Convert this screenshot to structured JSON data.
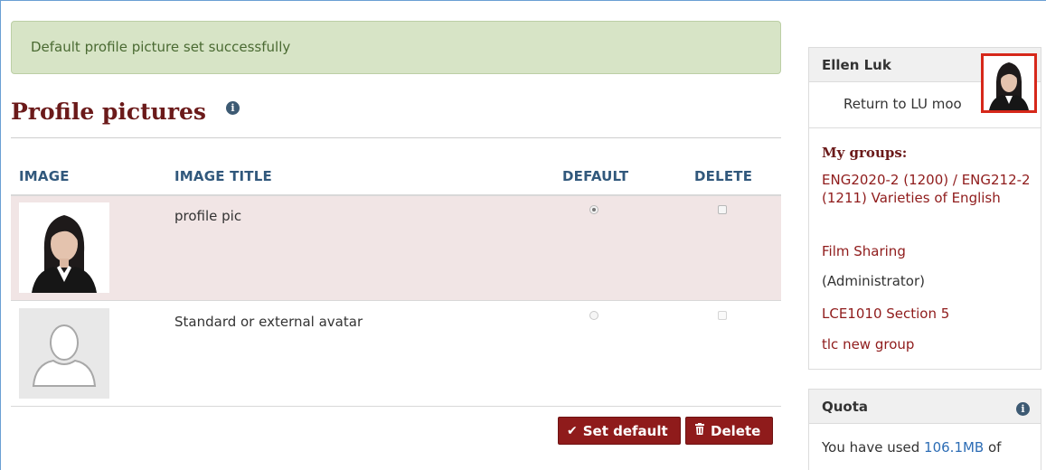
{
  "alert": {
    "message": "Default profile picture set successfully"
  },
  "page": {
    "title": "Profile pictures",
    "info_icon": "info-circle-icon"
  },
  "table": {
    "headers": {
      "image": "IMAGE",
      "title": "IMAGE TITLE",
      "default": "DEFAULT",
      "delete": "DELETE"
    },
    "rows": [
      {
        "title": "profile pic",
        "default_selected": true,
        "delete_enabled": true
      },
      {
        "title": "Standard or external avatar",
        "default_selected": false,
        "delete_enabled": false
      }
    ]
  },
  "actions": {
    "set_default_label": "Set default",
    "set_default_icon": "check-icon",
    "delete_label": "Delete",
    "delete_icon": "trash-icon"
  },
  "sidebar": {
    "user_card": {
      "name": "Ellen Luk",
      "return_link": "Return to LU moo",
      "groups_title": "My groups:",
      "groups": [
        "ENG2020-2 (1200) / ENG212-2 (1211) Varieties of English",
        "Film Sharing",
        "LCE1010 Section 5",
        "tlc new group"
      ],
      "admin_note": "(Administrator)"
    },
    "quota_card": {
      "title": "Quota",
      "text_prefix": "You have used ",
      "amount": "106.1MB",
      "text_suffix": " of"
    }
  },
  "colors": {
    "alert_bg": "#d7e4c6",
    "heading": "#6b1a1a",
    "table_header": "#31587c",
    "selected_row": "#f1e5e5",
    "button": "#8f1b1b",
    "link": "#8f1b1b",
    "highlight_box": "#d6281a",
    "quota_amount": "#2d6db5"
  }
}
